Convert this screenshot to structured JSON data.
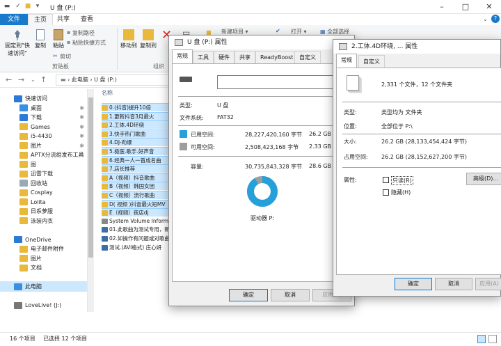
{
  "explorer": {
    "window_title": "U 盘 (P:)",
    "ribbon_tabs": [
      "文件",
      "主页",
      "共享",
      "查看"
    ],
    "ribbon": {
      "pin_quick": "固定到\"快\n速访问\"",
      "copy": "复制",
      "paste": "粘贴",
      "copy_path": "复制路径",
      "paste_shortcut": "粘贴快捷方式",
      "cut": "剪切",
      "group_clipboard": "剪贴板",
      "move_to": "移动到",
      "copy_to": "复制到",
      "group_organize": "组织",
      "new_item": "新建项目",
      "open": "打开",
      "select_all": "全部选择"
    },
    "address": {
      "path": "› 此电脑 › U 盘 (P:)"
    },
    "nav": [
      {
        "label": "快速访问",
        "color": "#2b7bd6",
        "pinned": false
      },
      {
        "label": "桌面",
        "color": "#3a8fe0",
        "pinned": true
      },
      {
        "label": "下载",
        "color": "#2b7bd6",
        "pinned": true
      },
      {
        "label": "Games",
        "color": "#e8b93a",
        "pinned": true
      },
      {
        "label": "i5-4430",
        "color": "#e8b93a",
        "pinned": true
      },
      {
        "label": "图片",
        "color": "#e8b93a",
        "pinned": true
      },
      {
        "label": "APTX分流组发布工具",
        "color": "#e8b93a",
        "pinned": true
      },
      {
        "label": "图",
        "color": "#e8b93a",
        "pinned": false
      },
      {
        "label": "迅雷下载",
        "color": "#e8b93a",
        "pinned": false
      },
      {
        "label": "回收站",
        "color": "#9aa9b8",
        "pinned": false
      },
      {
        "label": "Cosplay",
        "color": "#e8b93a",
        "pinned": false
      },
      {
        "label": "Lolita",
        "color": "#e8b93a",
        "pinned": false
      },
      {
        "label": "日系萝服",
        "color": "#e8b93a",
        "pinned": false
      },
      {
        "label": "泳装内衣",
        "color": "#e8b93a",
        "pinned": false
      },
      {
        "label": "",
        "color": "",
        "pinned": false
      },
      {
        "label": "OneDrive",
        "color": "#2b7bd6",
        "pinned": false
      },
      {
        "label": "电子邮件附件",
        "color": "#e8b93a",
        "pinned": false
      },
      {
        "label": "图片",
        "color": "#e8b93a",
        "pinned": false
      },
      {
        "label": "文档",
        "color": "#e8b93a",
        "pinned": false
      },
      {
        "label": "",
        "color": "",
        "pinned": false
      },
      {
        "label": "此电脑",
        "color": "#3a8fe0",
        "pinned": false
      },
      {
        "label": "",
        "color": "",
        "pinned": false
      },
      {
        "label": "LoveLive! (J:)",
        "color": "#777777",
        "pinned": false
      }
    ],
    "files_header": "名称",
    "files": [
      {
        "name": "0.(抖音)提升10倍",
        "type": "folder",
        "selected": true
      },
      {
        "name": "1.更新抖音3月最火",
        "type": "folder",
        "selected": true
      },
      {
        "name": "2.工体.4D环绕",
        "type": "folder",
        "selected": true
      },
      {
        "name": "3.快手热门歌曲",
        "type": "folder",
        "selected": true
      },
      {
        "name": "4.DJ-劲爆",
        "type": "folder",
        "selected": true
      },
      {
        "name": "5.极医.歌手.好声音",
        "type": "folder",
        "selected": true
      },
      {
        "name": "6.经典一人一首成名曲",
        "type": "folder",
        "selected": true
      },
      {
        "name": "7.店长推荐",
        "type": "folder",
        "selected": true
      },
      {
        "name": "A（视频）抖音歌曲",
        "type": "folder",
        "selected": true
      },
      {
        "name": "B（视频）韩国女团",
        "type": "folder",
        "selected": true
      },
      {
        "name": "C（视频）流行歌曲",
        "type": "folder",
        "selected": true
      },
      {
        "name": "D( 视频 )抖音最火短MV",
        "type": "folder",
        "selected": true
      },
      {
        "name": "E（视频）夜店dj",
        "type": "folder",
        "selected": true
      },
      {
        "name": "System Volume Inform",
        "type": "sys",
        "selected": false
      },
      {
        "name": "01.此歌曲为测试专用，新",
        "type": "vid",
        "selected": false
      },
      {
        "name": "02.如操作有问题或对歌曲",
        "type": "vid",
        "selected": false
      },
      {
        "name": "测试.(AVI格式) 庄心妍",
        "type": "vid",
        "selected": false
      }
    ],
    "status": {
      "count": "16 个项目",
      "selected": "已选择 12 个项目"
    }
  },
  "drive_props": {
    "title": "U 盘 (P:) 属性",
    "tabs": [
      "常规",
      "工具",
      "硬件",
      "共享",
      "ReadyBoost",
      "自定义"
    ],
    "type_label": "类型:",
    "type_value": "U 盘",
    "fs_label": "文件系统:",
    "fs_value": "FAT32",
    "used_label": "已用空间:",
    "used_bytes": "28,227,420,160 字节",
    "used_gb": "26.2 GB",
    "free_label": "可用空间:",
    "free_bytes": "2,508,423,168 字节",
    "free_gb": "2.33 GB",
    "cap_label": "容量:",
    "cap_bytes": "30,735,843,328 字节",
    "cap_gb": "28.6 GB",
    "drive_label": "驱动器 P:",
    "used_fraction": 0.918,
    "used_color": "#26a0da",
    "free_color": "#9e9e9e",
    "buttons": {
      "ok": "确定",
      "cancel": "取消",
      "apply": "应用(A)"
    }
  },
  "folder_props": {
    "title": "2.工体.4D环绕, ... 属性",
    "tabs": [
      "常规",
      "自定义"
    ],
    "summary": "2,331 个文件，12 个文件夹",
    "type_label": "类型:",
    "type_value": "类型均为 文件夹",
    "loc_label": "位置:",
    "loc_value": "全部位于 P:\\",
    "size_label": "大小:",
    "size_value": "26.2 GB (28,133,454,424 字节)",
    "disk_label": "占用空间:",
    "disk_value": "26.2 GB (28,152,627,200 字节)",
    "attr_label": "属性:",
    "readonly": "只读(R)",
    "hidden": "隐藏(H)",
    "advanced": "高级(D)...",
    "buttons": {
      "ok": "确定",
      "cancel": "取消",
      "apply": "应用(A)"
    }
  }
}
